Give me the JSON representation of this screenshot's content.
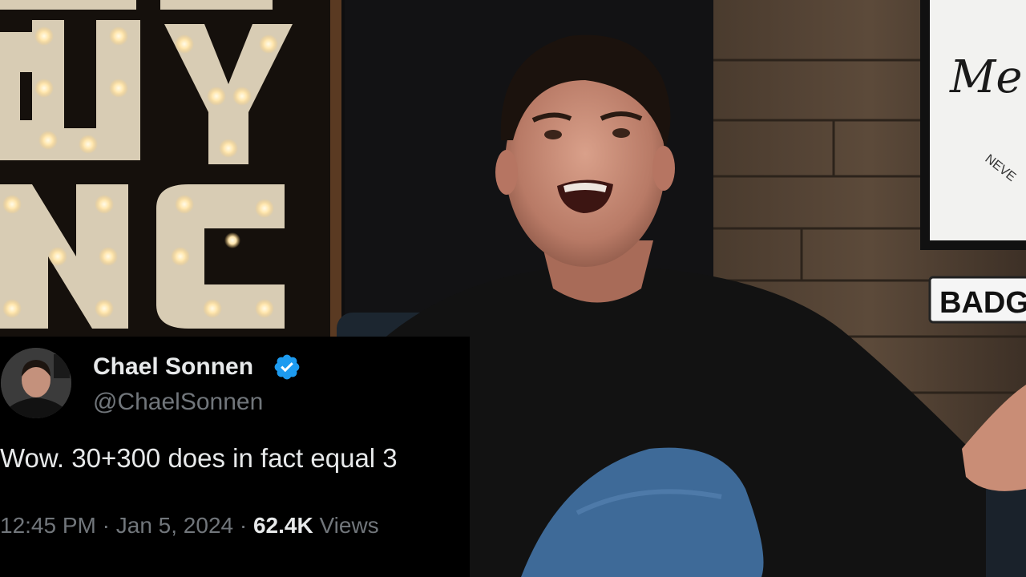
{
  "background": {
    "marquee_letters": "GUY INC",
    "wall_sign_text": "Me",
    "wall_sign_subtext": "NEVE",
    "plate_text": "BADG"
  },
  "tweet": {
    "display_name": "Chael Sonnen",
    "verified_icon": "verified-badge-icon",
    "handle": "@ChaelSonnen",
    "text": "Wow. 30+300 does in fact equal 3",
    "time": "12:45 PM",
    "separator": " · ",
    "date": "Jan 5, 2024",
    "views_count": "62.4K",
    "views_label": " Views"
  },
  "colors": {
    "verified_blue": "#1d9bf0",
    "text_primary": "#e7e9ea",
    "text_secondary": "#71767b"
  }
}
